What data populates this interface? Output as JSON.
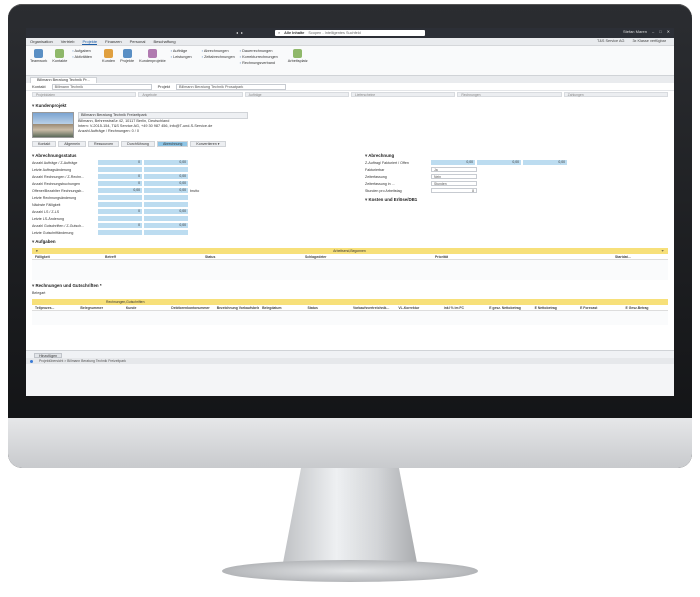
{
  "titlebar": {
    "search_scope": "Alle Inhalte",
    "search_placeholder": "Scopen - Intelligentes Suchfeld",
    "user": "Stefan Maren"
  },
  "menubar": {
    "items": [
      "Organisation",
      "Vertrieb",
      "Projekte",
      "Finanzen",
      "Personal",
      "Beschaffung"
    ],
    "company": "T&S Service AG",
    "flag": "3x Klasse verfügbar"
  },
  "ribbon": {
    "teamwork": "Teamwork",
    "kontakte": "Kontakte",
    "aufgaben": "Aufgaben",
    "aktivitaeten": "Aktivitäten",
    "kunden": "Kunden",
    "projekte": "Projekte",
    "kundenprojekte": "Kundenprojekte",
    "auftraege": "Aufträge",
    "leistungen": "Leistungen",
    "abrechnungen": "Abrechnungen",
    "zeitabrechnungen": "Zeitabrechnungen",
    "dauerrechnungen": "Dauerrechnungen",
    "korrekturrechnungen": "Korrekturrechnungen",
    "rechnungsverband": "Rechnungsverband",
    "arbeitsplatz": "Arbeitsplatz"
  },
  "doctab": "Billmann Beratung Technik Pr...",
  "toolbar2": {
    "kontakt_label": "Kontakt",
    "kontakt_value": "Billmann Technik",
    "projekt_label": "Projekt",
    "projekt_value": "Billmann Beratung Technik Prosatpark"
  },
  "steps": [
    "Projektdaten",
    "Angebote",
    "Aufträge",
    "Lieferscheine",
    "Rechnungen",
    "Zahlungen"
  ],
  "kundenprojekt": {
    "title": "Kundenprojekt",
    "name": "Billmann Beratung Technik Freizeitpark",
    "address": "Billmann, Behrenstraße 42, 10117 Berlin, Deutschland",
    "contact": "Intern: V-2015-154, T&S Service AG, +49 30 987 456, info@T-und-S-Service.de",
    "counts": "Anzahl Aufträge / Rechnungen: 0 / 0",
    "tabs": [
      "Kontakt",
      "Allgemein",
      "Ressourcen",
      "Durchführung",
      "Abrechnung",
      "Konvertieren ▾"
    ]
  },
  "abrechnungsstatus": {
    "title": "Abrechnungsstatus",
    "rows": [
      {
        "label": "Anzahl Aufträge / Z-Aufträge",
        "v1": "0",
        "v2": "0,00"
      },
      {
        "label": "Letzte Auftragsänderung",
        "v1": "",
        "v2": ""
      },
      {
        "label": "Anzahl Rechnungen / Z-Rechn...",
        "v1": "0",
        "v2": "0,00"
      },
      {
        "label": "Anzahl Rechnungsbuchungen",
        "v1": "0",
        "v2": "0,00"
      },
      {
        "label": "Offener/Bezahlter Rechnungsb...",
        "v1": "0,00",
        "v2": "0,00",
        "extra": "brutto"
      },
      {
        "label": "Letzte Rechnungsänderung",
        "v1": "",
        "v2": ""
      },
      {
        "label": "Nächste Fälligkeit",
        "v1": "",
        "v2": ""
      },
      {
        "label": "Anzahl LS / Z-LS",
        "v1": "0",
        "v2": "0,00"
      },
      {
        "label": "Letzte LS-Änderung",
        "v1": "",
        "v2": ""
      },
      {
        "label": "Anzahl Gutschriften / Z-Gutsch...",
        "v1": "0",
        "v2": "0,00"
      },
      {
        "label": "Letzte Gutschriftänderung",
        "v1": "",
        "v2": ""
      }
    ]
  },
  "abrechnung": {
    "title": "Abrechnung",
    "rows": [
      {
        "label": "Z-Auftrag/ Fakturiert / Offen",
        "v1": "0,00",
        "v2": "0,00",
        "v3": "0,00"
      },
      {
        "label": "Fakturierbar",
        "value": "Ja"
      },
      {
        "label": "Zeiterfassung",
        "value": "Nein"
      },
      {
        "label": "Zeiterfassung in ...",
        "value": "Stunden"
      },
      {
        "label": "Stunden pro Arbeitstag",
        "value": "8"
      }
    ],
    "kosten_title": "Kosten und Erlöse/DB1"
  },
  "aufgaben": {
    "title": "Aufgaben",
    "filter": "Arbeitsend,Begonnen",
    "columns": [
      "Fälligkeit",
      "Betreff",
      "Status",
      "Schlagwörter",
      "Priorität",
      "Startdat..."
    ]
  },
  "rechnungen": {
    "title": "Rechnungen und Gutschriften *",
    "belegart_label": "Belegart",
    "belegart_value": "Rechnungen,Gutschriften",
    "columns": [
      "Teilprozes...",
      "Belegnummer",
      "Kunde",
      "Debitorenkontonummer",
      "Bezeichnung Vorkaufsbeleg",
      "Belegdatum",
      "Status",
      "Vorkaufsvertreichnik...",
      "VL-Korrektur",
      "inkl % im FC",
      "E gesz. Nettobetrag",
      "E Nettobetrag",
      "E Forecast",
      "E Gesz.Betrag"
    ]
  },
  "footer": {
    "add_button": "Hinzufügen",
    "breadcrumb": "Projektübersicht > Billmann Beratung Technik Freizeitpark"
  }
}
